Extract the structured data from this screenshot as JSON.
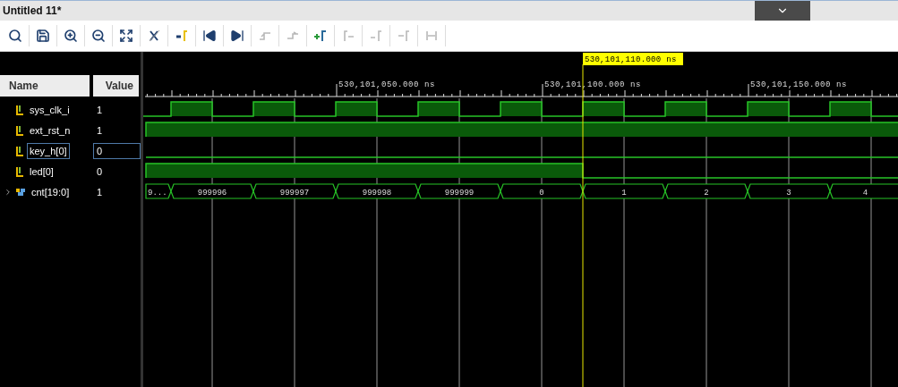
{
  "window": {
    "title": "Untitled 11*"
  },
  "toolbar": [
    {
      "disabled": false
    },
    {
      "disabled": false
    },
    {
      "disabled": false
    },
    {
      "disabled": false
    },
    {
      "disabled": false
    },
    {
      "disabled": false
    },
    {
      "disabled": false
    },
    {
      "disabled": false
    },
    {
      "disabled": false
    },
    {
      "disabled": true
    },
    {
      "disabled": true
    },
    {
      "disabled": false
    },
    {
      "disabled": true
    },
    {
      "disabled": true
    },
    {
      "disabled": true
    },
    {
      "disabled": true
    }
  ],
  "columns": {
    "name": "Name",
    "value": "Value"
  },
  "signals": [
    {
      "name": "sys_clk_i",
      "value": "1",
      "kind": "clock",
      "selected": false
    },
    {
      "name": "ext_rst_n",
      "value": "1",
      "kind": "high",
      "selected": false
    },
    {
      "name": "key_h[0]",
      "value": "0",
      "kind": "low",
      "selected": true
    },
    {
      "name": "led[0]",
      "value": "0",
      "kind": "falling",
      "selected": false
    },
    {
      "name": "cnt[19:0]",
      "value": "1",
      "kind": "bus",
      "selected": false,
      "expanded": false,
      "segments": [
        "9...",
        "999996",
        "999997",
        "999998",
        "999999",
        "0",
        "1",
        "2",
        "3",
        "4"
      ]
    }
  ],
  "ruler": {
    "labels": [
      "530,101,050.000 ns",
      "530,101,100.000 ns",
      "530,101,150.000 ns"
    ]
  },
  "cursor": {
    "label": "530,101,110.000 ns"
  }
}
